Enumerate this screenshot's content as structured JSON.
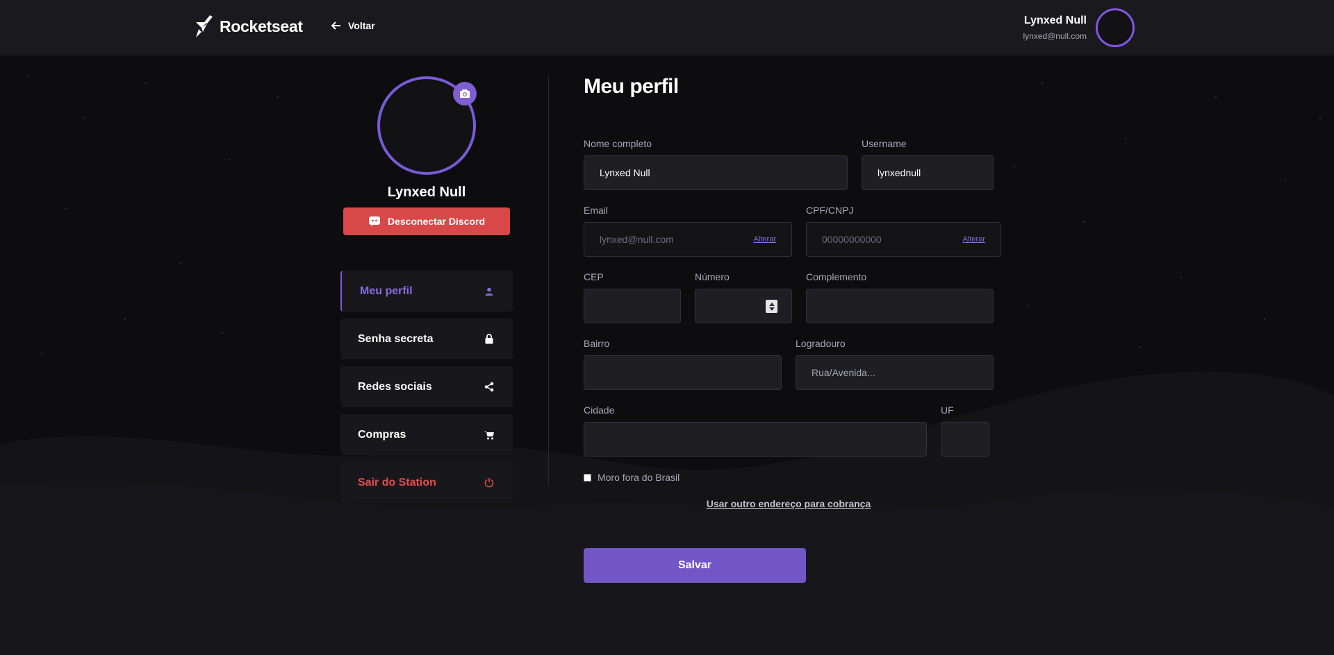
{
  "header": {
    "brand": "Rocketseat",
    "back_label": "Voltar",
    "user_name": "Lynxed Null",
    "user_email": "lynxed@null.com"
  },
  "sidebar": {
    "profile_name": "Lynxed Null",
    "discord_button": "Desconectar Discord",
    "items": [
      {
        "label": "Meu perfil",
        "icon": "user-icon",
        "active": true
      },
      {
        "label": "Senha secreta",
        "icon": "lock-icon"
      },
      {
        "label": "Redes sociais",
        "icon": "share-icon"
      },
      {
        "label": "Compras",
        "icon": "cart-icon"
      },
      {
        "label": "Sair do Station",
        "icon": "power-icon",
        "danger": true
      }
    ]
  },
  "form": {
    "title": "Meu perfil",
    "full_name": {
      "label": "Nome completo",
      "value": "Lynxed Null"
    },
    "username": {
      "label": "Username",
      "value": "lynxednull"
    },
    "email": {
      "label": "Email",
      "placeholder": "lynxed@null.com",
      "action": "Alterar"
    },
    "cpf": {
      "label": "CPF/CNPJ",
      "placeholder": "00000000000",
      "action": "Alterar"
    },
    "cep": {
      "label": "CEP",
      "value": ""
    },
    "numero": {
      "label": "Número",
      "value": ""
    },
    "complemento": {
      "label": "Complemento",
      "value": ""
    },
    "bairro": {
      "label": "Bairro",
      "value": ""
    },
    "logradouro": {
      "label": "Logradouro",
      "placeholder": "Rua/Avenida..."
    },
    "cidade": {
      "label": "Cidade",
      "value": ""
    },
    "uf": {
      "label": "UF",
      "value": ""
    },
    "abroad_checkbox": {
      "label": "Moro fora do Brasil",
      "checked": false
    },
    "billing_link": "Usar outro endereço para cobrança",
    "save_button": "Salvar"
  },
  "colors": {
    "accent": "#8257e5",
    "danger": "#d94848",
    "background": "#0d0d10",
    "surface": "#1a1a1e"
  }
}
